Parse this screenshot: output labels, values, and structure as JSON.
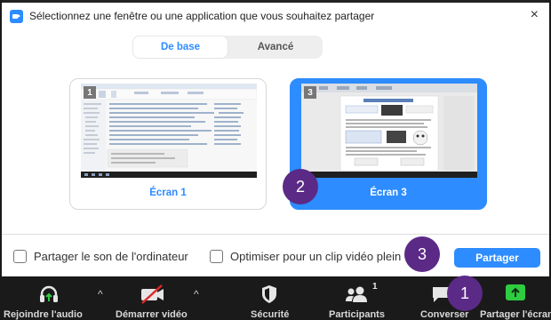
{
  "dialog": {
    "title": "Sélectionnez une fenêtre ou une application que vous souhaitez partager",
    "close_glyph": "×"
  },
  "tabs": [
    {
      "label": "De base",
      "active": true
    },
    {
      "label": "Avancé",
      "active": false
    }
  ],
  "screens": [
    {
      "number": "1",
      "label": "Écran 1",
      "selected": false
    },
    {
      "number": "3",
      "label": "Écran 3",
      "selected": true
    }
  ],
  "callouts": [
    "2",
    "3",
    "1"
  ],
  "options": {
    "share_sound": {
      "label": "Partager le son de l'ordinateur",
      "checked": false
    },
    "optimize_video": {
      "label": "Optimiser pour un clip vidéo plein",
      "checked": false
    }
  },
  "share_button": {
    "label": "Partager"
  },
  "toolbar": {
    "join_audio": "Rejoindre l'audio",
    "start_video": "Démarrer vidéo",
    "security": "Sécurité",
    "participants": "Participants",
    "participants_count": "1",
    "chat": "Converser",
    "share_screen": "Partager l'écran",
    "caret_glyph": "^"
  },
  "colors": {
    "accent": "#2d8cff",
    "callout": "#5b2a86",
    "toolbar_bg": "#1a1a1a",
    "share_green": "#2ecc40"
  },
  "icons": {
    "app": "zoom-share-icon",
    "close": "close-icon",
    "audio": "headphones-icon",
    "video": "video-off-icon",
    "security": "shield-icon",
    "participants": "people-icon",
    "chat": "chat-bubble-icon",
    "share": "share-arrow-icon"
  }
}
